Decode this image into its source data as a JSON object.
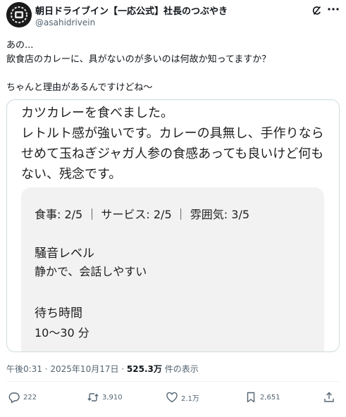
{
  "tweet": {
    "author_name": "朝日ドライブイン【一応公式】社長のつぶやき",
    "author_handle": "@asahidrivein",
    "text": "あの...\n飲食店のカレーに、具がないのが多いのは何故か知ってますか？\n\nちゃんと理由があるんですけどね〜",
    "timestamp": "午後0:31 · 2025年10月17日 · ",
    "views_count": "525.3万",
    "views_label": " 件の表示"
  },
  "card": {
    "review_text": "カツカレーを食べました。\nレトルト感が強いです。カレーの具無し、手作りならせめて玉ねぎジャガ人参の食感あっても良いけど何もない、残念です。",
    "ratings": "食事: 2/5 ｜ サービス: 2/5 ｜ 雰囲気: 3/5",
    "noise_title": "騒音レベル",
    "noise_value": "静かで、会話しやすい",
    "wait_title": "待ち時間",
    "wait_value": "10〜30 分"
  },
  "actions": {
    "replies": "222",
    "reposts": "3,910",
    "likes": "2.1万",
    "bookmarks": "2,651"
  },
  "icons": [
    "grok-icon",
    "more-icon",
    "reply-icon",
    "repost-icon",
    "like-icon",
    "bookmark-icon",
    "share-icon"
  ]
}
